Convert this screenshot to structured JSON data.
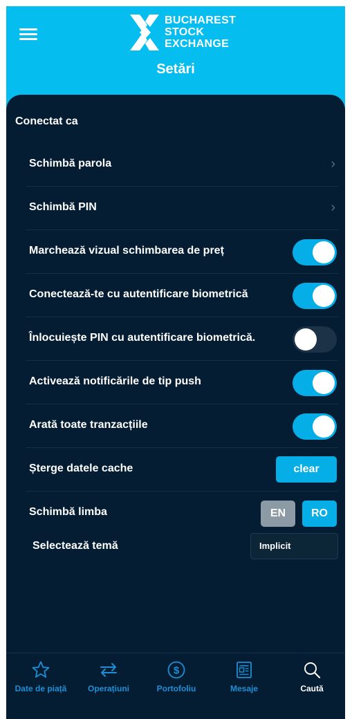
{
  "header": {
    "logo_lines": [
      "BUCHAREST",
      "STOCK",
      "EXCHANGE"
    ],
    "title": "Setări"
  },
  "settings": {
    "connected_label": "Conectat ca",
    "rows": [
      {
        "label": "Schimbă parola",
        "control": "chevron"
      },
      {
        "label": "Schimbă PIN",
        "control": "chevron"
      },
      {
        "label": "Marchează vizual schimbarea de preț",
        "control": "toggle",
        "on": true
      },
      {
        "label": "Conectează-te cu autentificare biometrică",
        "control": "toggle",
        "on": true
      },
      {
        "label": "Înlocuiește PIN cu autentificare biometrică.",
        "control": "toggle",
        "on": false
      },
      {
        "label": "Activează notificările de tip push",
        "control": "toggle",
        "on": true
      },
      {
        "label": "Arată toate tranzacțiile",
        "control": "toggle",
        "on": true
      },
      {
        "label": "Șterge datele cache",
        "control": "button",
        "button_label": "clear"
      },
      {
        "label": "Schimbă limba",
        "control": "language",
        "options": [
          "EN",
          "RO"
        ],
        "selected": "RO"
      }
    ],
    "theme": {
      "label": "Selectează temă",
      "value": "Implicit"
    }
  },
  "bottom_nav": [
    {
      "label": "Date de piață",
      "icon": "star-icon"
    },
    {
      "label": "Operațiuni",
      "icon": "transfer-arrows-icon"
    },
    {
      "label": "Portofoliu",
      "icon": "dollar-circle-icon"
    },
    {
      "label": "Mesaje",
      "icon": "newspaper-icon"
    },
    {
      "label": "Caută",
      "icon": "search-icon",
      "active": true
    }
  ],
  "colors": {
    "accent": "#06aee8",
    "header_bg": "#06bdf0",
    "panel_bg": "#041d33",
    "nav_inactive": "#1d8fd6"
  }
}
